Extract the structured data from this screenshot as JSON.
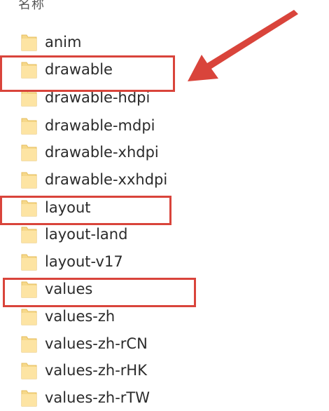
{
  "header": {
    "column_name": "名称"
  },
  "folders": [
    {
      "name": "anim"
    },
    {
      "name": "drawable"
    },
    {
      "name": "drawable-hdpi"
    },
    {
      "name": "drawable-mdpi"
    },
    {
      "name": "drawable-xhdpi"
    },
    {
      "name": "drawable-xxhdpi"
    },
    {
      "name": "layout"
    },
    {
      "name": "layout-land"
    },
    {
      "name": "layout-v17"
    },
    {
      "name": "values"
    },
    {
      "name": "values-zh"
    },
    {
      "name": "values-zh-rCN"
    },
    {
      "name": "values-zh-rHK"
    },
    {
      "name": "values-zh-rTW"
    }
  ],
  "highlighted_folders": [
    "drawable",
    "layout",
    "values"
  ],
  "colors": {
    "highlight": "#d9443b",
    "folder_body": "#f6d88a",
    "folder_front": "#fde4a3",
    "folder_edge": "#e6be5e"
  },
  "icons": {
    "folder": "folder-icon",
    "arrow": "pointer-arrow"
  }
}
